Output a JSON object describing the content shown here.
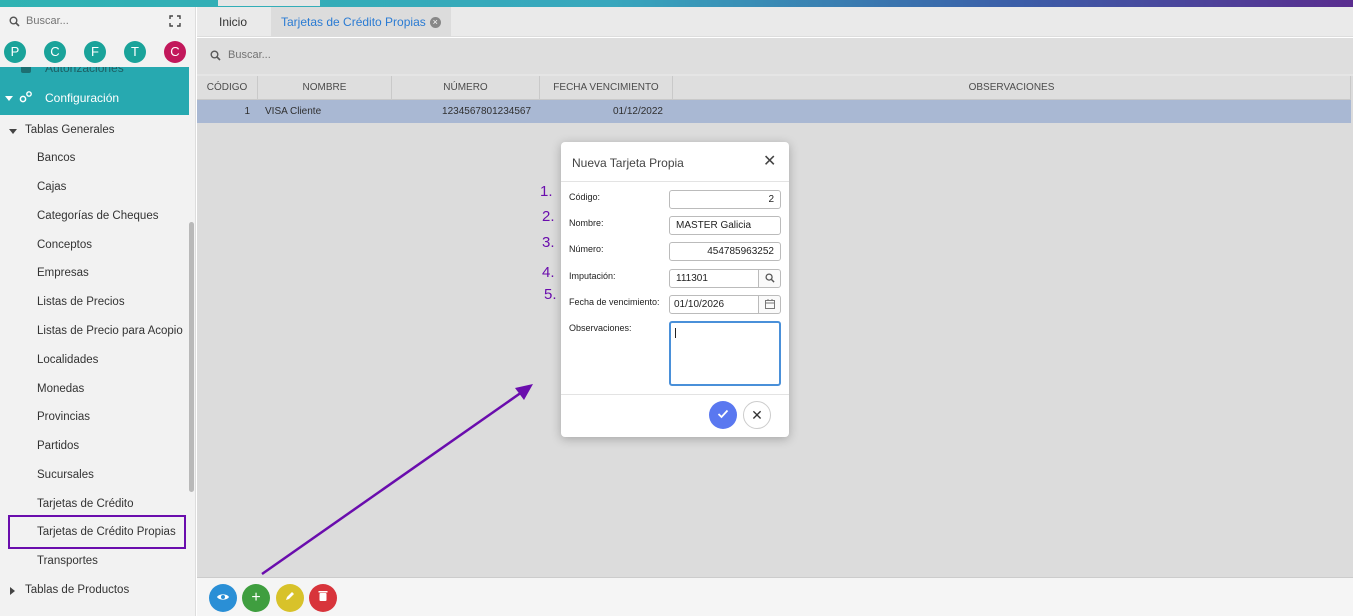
{
  "sidebar": {
    "search_placeholder": "Buscar...",
    "avatars": [
      {
        "letter": "P",
        "color": "#1aa39a"
      },
      {
        "letter": "C",
        "color": "#1aa39a"
      },
      {
        "letter": "F",
        "color": "#1aa39a"
      },
      {
        "letter": "T",
        "color": "#1aa39a"
      },
      {
        "letter": "C",
        "color": "#c2185b"
      }
    ],
    "partial_item": "Autorizaciones",
    "config_label": "Configuración",
    "group_label": "Tablas Generales",
    "items": [
      "Bancos",
      "Cajas",
      "Categorías de Cheques",
      "Conceptos",
      "Empresas",
      "Listas de Precios",
      "Listas de Precio para Acopio",
      "Localidades",
      "Monedas",
      "Provincias",
      "Partidos",
      "Sucursales",
      "Tarjetas de Crédito",
      "Tarjetas de Crédito Propias",
      "Transportes"
    ],
    "selected_index": 13,
    "group2_label": "Tablas de Productos"
  },
  "tabs": [
    {
      "label": "Inicio"
    },
    {
      "label": "Tarjetas de Crédito Propias"
    }
  ],
  "main": {
    "search_placeholder": "Buscar..."
  },
  "grid": {
    "columns": [
      "CÓDIGO",
      "NOMBRE",
      "NÚMERO",
      "FECHA VENCIMIENTO",
      "OBSERVACIONES"
    ],
    "rows": [
      {
        "codigo": "1",
        "nombre": "VISA Cliente",
        "numero": "1234567801234567",
        "fecha": "01/12/2022",
        "obs": ""
      }
    ]
  },
  "dialog": {
    "title": "Nueva Tarjeta Propia",
    "fields": {
      "codigo": {
        "label": "Código:",
        "value": "2"
      },
      "nombre": {
        "label": "Nombre:",
        "value": "MASTER Galicia"
      },
      "numero": {
        "label": "Número:",
        "value": "454785963252"
      },
      "imputacion": {
        "label": "Imputación:",
        "value": "111301"
      },
      "fecha": {
        "label": "Fecha de vencimiento:",
        "value": "01/10/2026"
      },
      "observaciones": {
        "label": "Observaciones:",
        "value": ""
      }
    }
  },
  "annotations": {
    "numbers": [
      "1.",
      "2.",
      "3.",
      "4.",
      "5."
    ],
    "color": "#6a0dad"
  },
  "colors": {
    "teal": "#27a9b0",
    "selected_row": "#b6c8ea",
    "accent_blue": "#2a7bd3",
    "ok_button": "#5a78f0",
    "fab_view": "#2a8fd6",
    "fab_add": "#3f9e3f",
    "fab_edit": "#d8c22a",
    "fab_delete": "#d8343b"
  }
}
